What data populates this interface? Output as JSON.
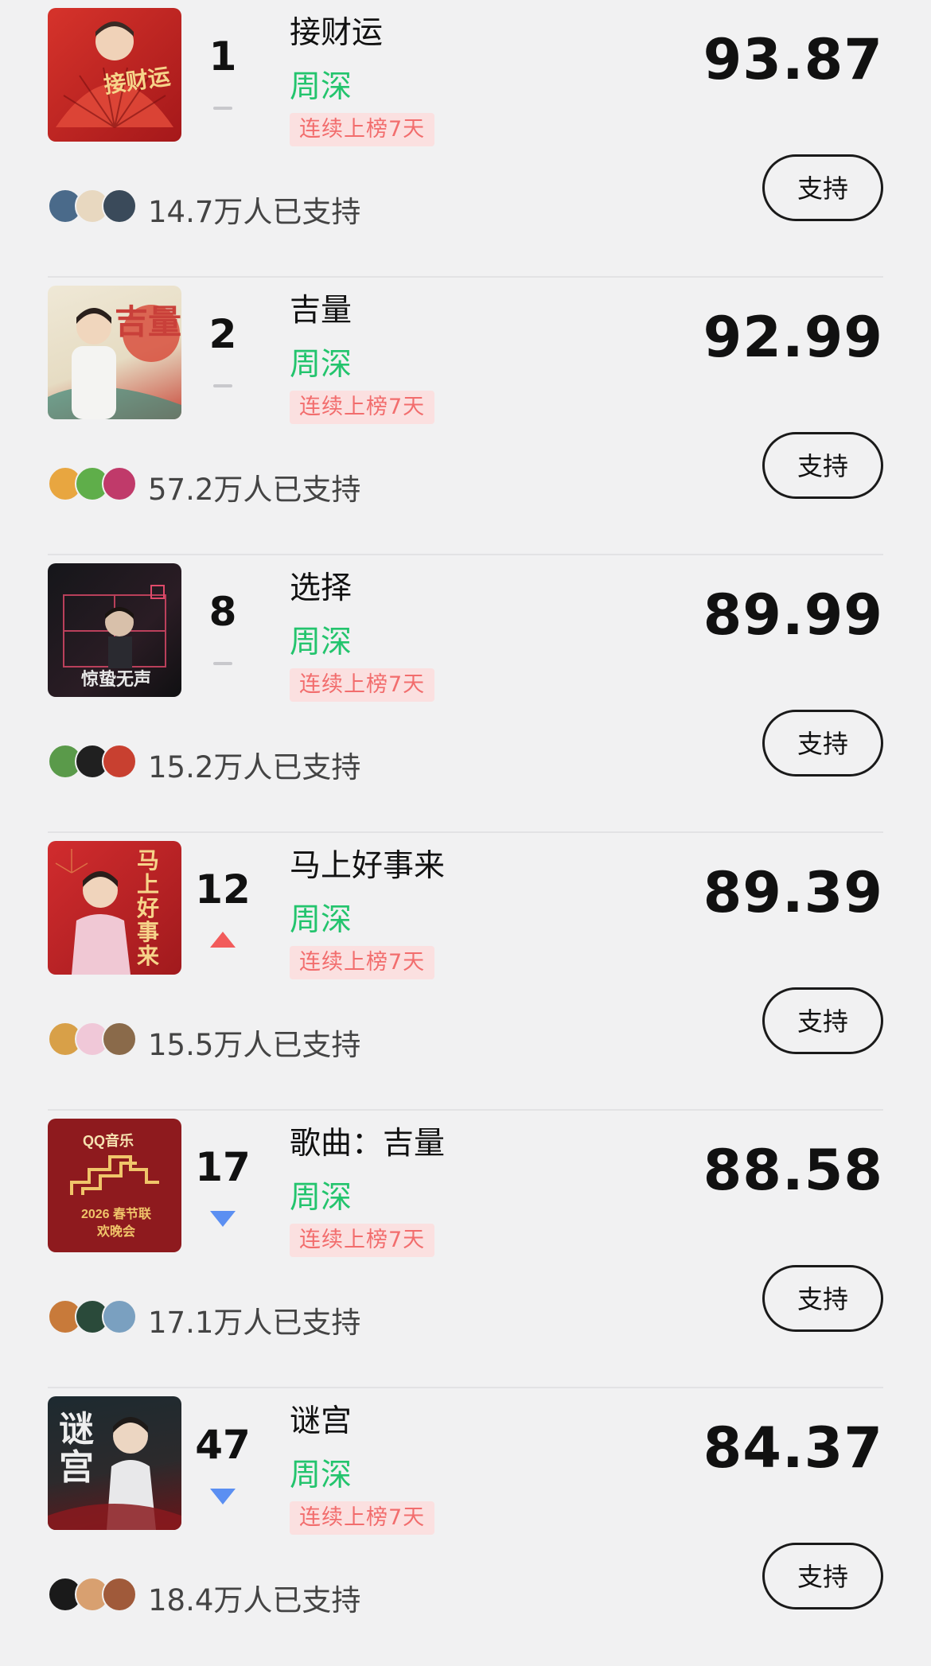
{
  "rows": [
    {
      "rank": "1",
      "trend": "flat",
      "title": "接财运",
      "artist": "周深",
      "streak": "连续上榜7天",
      "score": "93.87",
      "support_count": "14.7万人已支持",
      "button": "支持",
      "cover_text": "接财运",
      "colors": {
        "bg1": "#c8231e",
        "bg2": "#8f1512",
        "accent": "#f6d48a"
      },
      "avatar_colors": [
        "#4a6a8a",
        "#e8d8c0",
        "#3a4a5a"
      ]
    },
    {
      "rank": "2",
      "trend": "flat",
      "title": "吉量",
      "artist": "周深",
      "streak": "连续上榜7天",
      "score": "92.99",
      "support_count": "57.2万人已支持",
      "button": "支持",
      "cover_text": "吉量",
      "colors": {
        "bg1": "#e9e2cf",
        "bg2": "#c9403a",
        "accent": "#c9403a"
      },
      "avatar_colors": [
        "#e8a640",
        "#5fae4a",
        "#c03a6a"
      ]
    },
    {
      "rank": "8",
      "trend": "flat",
      "title": "选择",
      "artist": "周深",
      "streak": "连续上榜7天",
      "score": "89.99",
      "support_count": "15.2万人已支持",
      "button": "支持",
      "cover_text": "惊蛰无声",
      "colors": {
        "bg1": "#1b1c20",
        "bg2": "#3a1a22",
        "accent": "#e04a6a"
      },
      "avatar_colors": [
        "#5a9a4a",
        "#202020",
        "#c84030"
      ]
    },
    {
      "rank": "12",
      "trend": "up",
      "title": "马上好事来",
      "artist": "周深",
      "streak": "连续上榜7天",
      "score": "89.39",
      "support_count": "15.5万人已支持",
      "button": "支持",
      "cover_text": "马上好事来",
      "colors": {
        "bg1": "#c8262a",
        "bg2": "#9c1a1e",
        "accent": "#f4d27a"
      },
      "avatar_colors": [
        "#d8a048",
        "#f0c8d8",
        "#8a6a4a"
      ]
    },
    {
      "rank": "17",
      "trend": "down",
      "title": "歌曲：吉量",
      "artist": "周深",
      "streak": "连续上榜7天",
      "score": "88.58",
      "support_count": "17.1万人已支持",
      "button": "支持",
      "cover_text": "QQ音乐",
      "cover_sub": "2026 春节联欢晚会",
      "colors": {
        "bg1": "#8e1a1e",
        "bg2": "#7a1418",
        "accent": "#f0c56a"
      },
      "avatar_colors": [
        "#c87a3a",
        "#2a4a3a",
        "#7aa0c0"
      ]
    },
    {
      "rank": "47",
      "trend": "down",
      "title": "谜宫",
      "artist": "周深",
      "streak": "连续上榜7天",
      "score": "84.37",
      "support_count": "18.4万人已支持",
      "button": "支持",
      "cover_text": "谜宫",
      "colors": {
        "bg1": "#1d2a30",
        "bg2": "#5a1418",
        "accent": "#e8e8e8"
      },
      "avatar_colors": [
        "#1a1a1a",
        "#d8a070",
        "#a05a3a"
      ]
    }
  ]
}
